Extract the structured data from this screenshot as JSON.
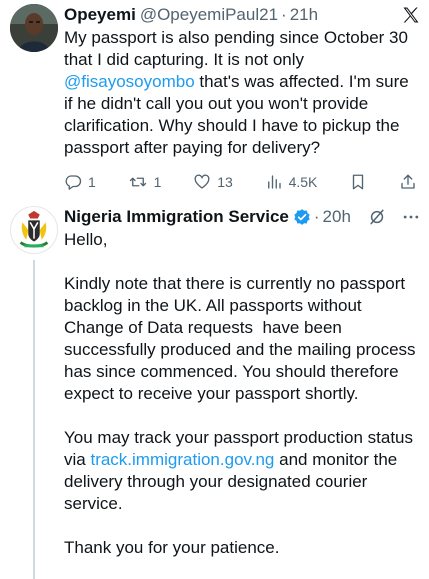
{
  "tweet1": {
    "name": "Opeyemi",
    "handle": "@OpeyemiPaul21",
    "separator": "·",
    "time": "21h",
    "body_before": "My passport is also pending since October 30 that I did capturing. It is not only ",
    "mention": "@fisayosoyombo",
    "body_after": " that's was affected. I'm sure if he didn't call you out you won't provide clarification. Why should I have to pickup the passport after paying for delivery?",
    "replies": "1",
    "retweets": "1",
    "likes": "13",
    "views": "4.5K"
  },
  "tweet2": {
    "name": "Nigeria Immigration Service",
    "separator": "·",
    "time": "20h",
    "body_part1": "Hello,\n\nKindly note that there is currently no passport backlog in the UK. All passports without Change of Data requests  have been successfully produced and the mailing process has since commenced. You should therefore expect to receive your passport shortly.\n\nYou may track your passport production status via ",
    "link": "track.immigration.gov.ng",
    "body_part2": " and monitor the delivery through your designated courier service.\n\nThank you for your patience."
  },
  "colors": {
    "accent": "#1d9bf0",
    "text": "#0f1419",
    "muted": "#536471",
    "verified": "#1d9bf0"
  },
  "icons": [
    "x-logo-icon",
    "reply-icon",
    "retweet-icon",
    "like-icon",
    "views-icon",
    "bookmark-icon",
    "share-icon",
    "verified-badge-icon",
    "grok-icon",
    "more-icon"
  ]
}
